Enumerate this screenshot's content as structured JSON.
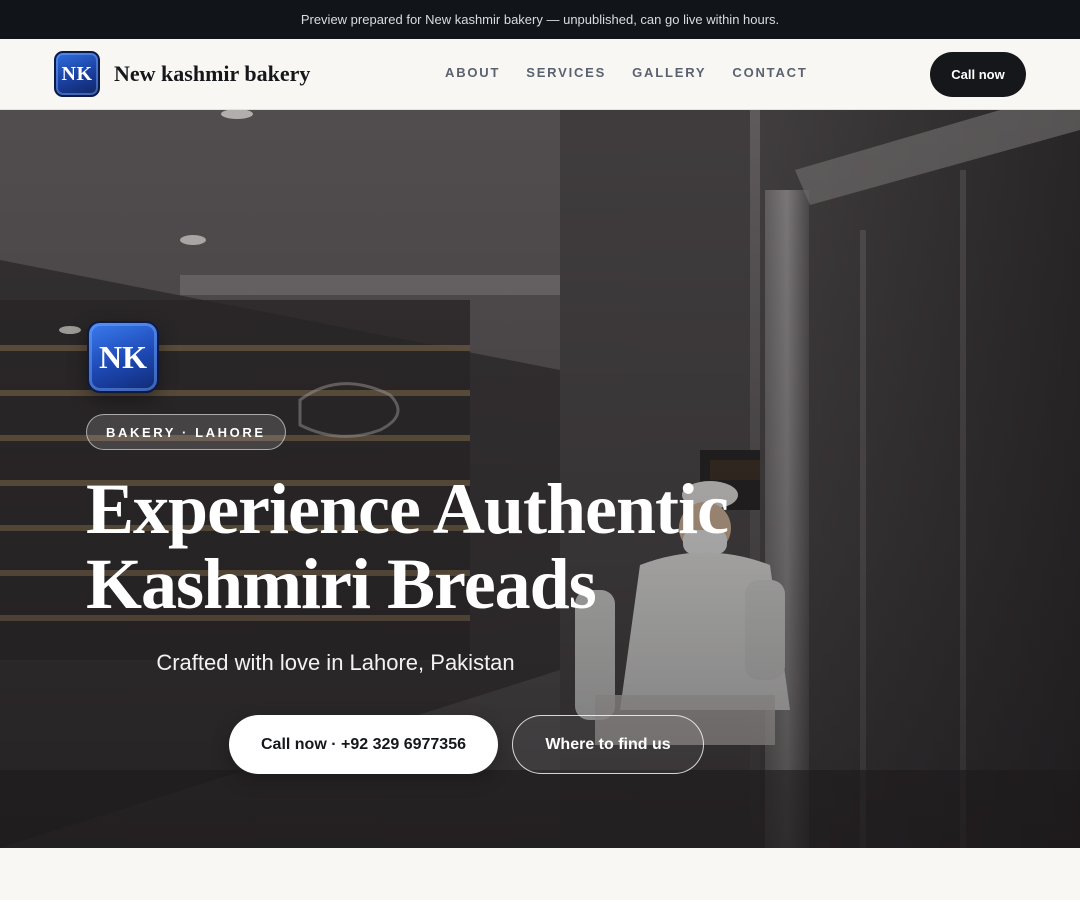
{
  "announcement": "Preview prepared for New kashmir bakery — unpublished, can go live within hours.",
  "nav": {
    "logo_initials": "NK",
    "brand_name": "New kashmir bakery",
    "links": [
      "ABOUT",
      "SERVICES",
      "GALLERY",
      "CONTACT"
    ],
    "cta_label": "Call now"
  },
  "hero": {
    "logo_initials": "NK",
    "badge": "BAKERY · LAHORE",
    "title": "Experience Authentic Kashmiri Breads",
    "subtitle": "Crafted with love in Lahore, Pakistan",
    "primary_button": "Call now · +92 329 6977356",
    "secondary_button": "Where to find us",
    "background_image": "bakery-interior-photo"
  },
  "colors": {
    "topbar": "#111419",
    "nav_background": "#f8f7f4",
    "accent_dark": "#15171b",
    "logo_blue": "#1d48b3"
  }
}
